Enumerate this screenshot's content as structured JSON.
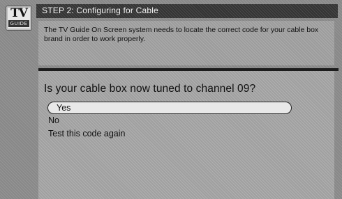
{
  "logo": {
    "line1": "TV",
    "line2": "GUIDE"
  },
  "header": {
    "title": "STEP 2: Configuring for Cable"
  },
  "info": {
    "text": "The TV Guide On Screen system needs to locate the correct code for your cable box brand in order to work properly."
  },
  "main": {
    "question": "Is your cable box now tuned to channel 09?",
    "options": [
      {
        "label": "Yes",
        "selected": true
      },
      {
        "label": "No",
        "selected": false
      },
      {
        "label": "Test this code again",
        "selected": false
      }
    ]
  }
}
